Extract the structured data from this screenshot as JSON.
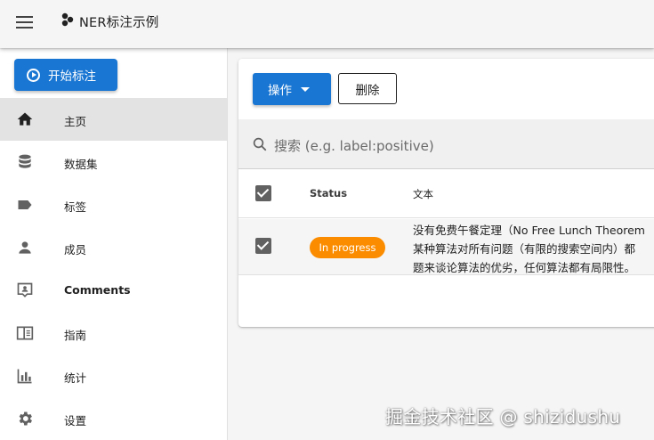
{
  "app": {
    "title": "NER标注示例",
    "menu_icon": "hamburger-menu-icon",
    "logo_icon": "logo-dots-icon"
  },
  "sidebar": {
    "start_button": {
      "label": "开始标注",
      "icon": "play-circle-icon"
    },
    "items": [
      {
        "label": "主页",
        "icon": "home-icon",
        "active": true
      },
      {
        "label": "数据集",
        "icon": "database-icon"
      },
      {
        "label": "标签",
        "icon": "label-tag-icon"
      },
      {
        "label": "成员",
        "icon": "person-icon"
      },
      {
        "label": "Comments",
        "icon": "comment-account-icon"
      },
      {
        "label": "指南",
        "icon": "book-open-icon"
      },
      {
        "label": "统计",
        "icon": "bar-chart-icon"
      },
      {
        "label": "设置",
        "icon": "gear-icon"
      }
    ]
  },
  "toolbar": {
    "action_label": "操作",
    "delete_label": "删除"
  },
  "search": {
    "placeholder": "搜索 (e.g. label:positive)"
  },
  "table": {
    "columns": [
      "Status",
      "文本"
    ],
    "rows": [
      {
        "checked": true,
        "status": "In progress",
        "text_lines": [
          "没有免费午餐定理（No Free Lunch Theorem",
          "某种算法对所有问题（有限的搜索空间内）都",
          "题来谈论算法的优劣，任何算法都有局限性。"
        ]
      }
    ]
  },
  "watermark": "掘金技术社区 @ shizidushu",
  "colors": {
    "primary": "#1976d2",
    "badge": "#fb8c00",
    "active_nav": "#e3e3e3"
  }
}
